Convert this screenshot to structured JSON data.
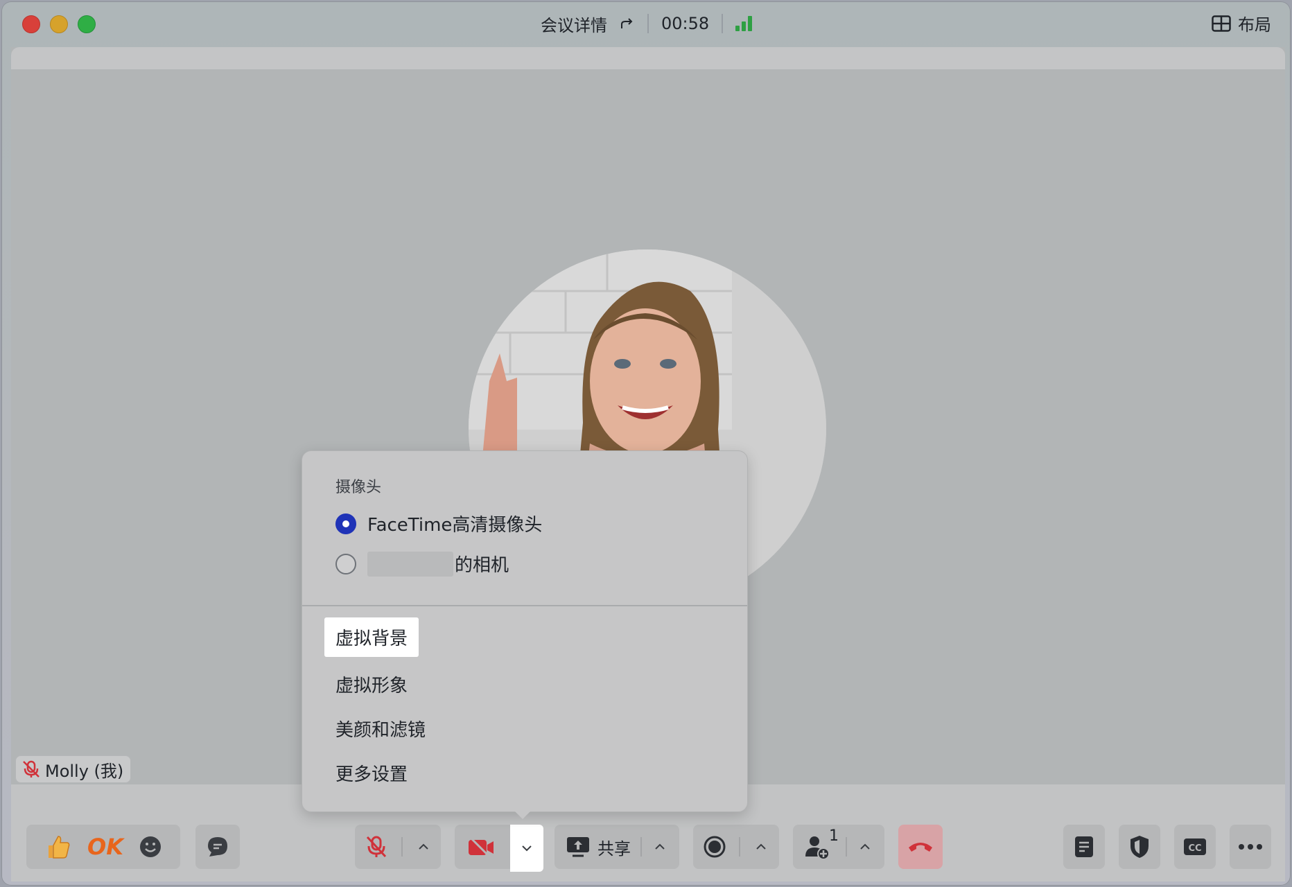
{
  "titlebar": {
    "meeting_details": "会议详情",
    "timer": "00:58",
    "layout_label": "布局",
    "signal_color": "#2ea043"
  },
  "participant": {
    "name": "Molly (我)"
  },
  "camera_menu": {
    "heading": "摄像头",
    "options": [
      {
        "label": "FaceTime高清摄像头",
        "selected": true
      },
      {
        "label": "的相机",
        "selected": false
      }
    ],
    "items": [
      "虚拟背景",
      "虚拟形象",
      "美颜和滤镜",
      "更多设置"
    ]
  },
  "toolbar": {
    "ok_label": "OK",
    "share_label": "共享",
    "participants_count": "1",
    "hangup_color": "#e0414a"
  },
  "icons": [
    "thumbs-up-icon",
    "smile-icon",
    "chat-icon",
    "mic-muted-icon",
    "camera-off-icon",
    "share-screen-icon",
    "record-icon",
    "add-person-icon",
    "hangup-icon",
    "notes-icon",
    "security-icon",
    "captions-icon",
    "more-icon",
    "layout-grid-icon"
  ]
}
